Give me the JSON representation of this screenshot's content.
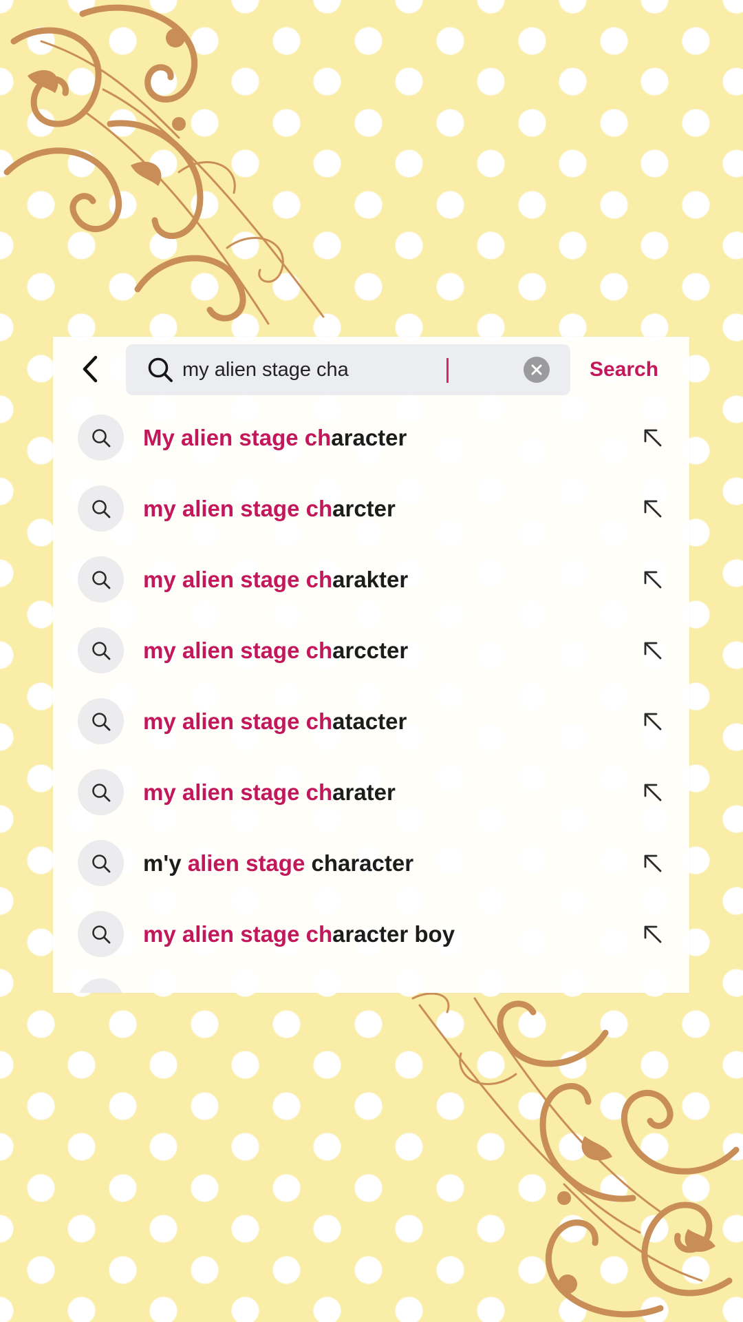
{
  "search": {
    "value": "my alien stage cha",
    "submit_label": "Search"
  },
  "icons": {
    "back": "chevron-left-icon",
    "search": "search-icon",
    "clear": "close-circle-icon",
    "fill": "arrow-up-left-icon"
  },
  "colors": {
    "accent": "#c2185b",
    "background": "#f9eda8",
    "ornament": "#c98e57"
  },
  "suggestions": [
    {
      "pre": "",
      "hl": "My alien stage ch",
      "post": "aracter"
    },
    {
      "pre": "",
      "hl": "my alien stage ch",
      "post": "arcter"
    },
    {
      "pre": "",
      "hl": "my alien stage ch",
      "post": "arakter"
    },
    {
      "pre": "",
      "hl": "my alien stage ch",
      "post": "arccter"
    },
    {
      "pre": "",
      "hl": "my alien stage ch",
      "post": "atacter"
    },
    {
      "pre": "",
      "hl": "my alien stage ch",
      "post": "arater"
    },
    {
      "pre": "m'y ",
      "hl": "alien stage",
      "post": " character"
    },
    {
      "pre": "",
      "hl": "my alien stage ch",
      "post": "aracter boy"
    }
  ]
}
